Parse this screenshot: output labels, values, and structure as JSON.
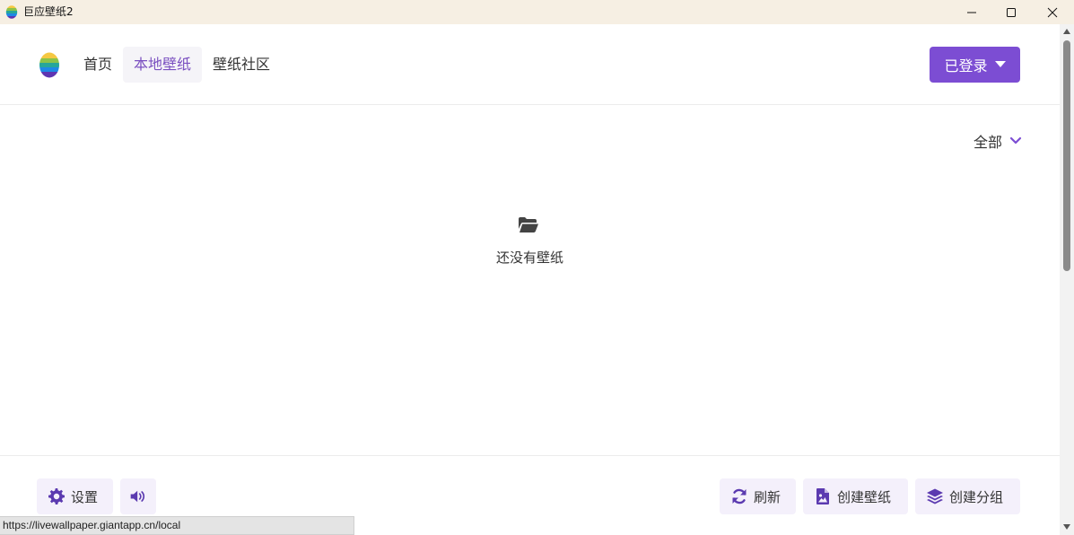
{
  "window": {
    "title": "巨应壁纸2",
    "controls": [
      "minimize",
      "maximize",
      "close"
    ]
  },
  "header": {
    "nav": [
      {
        "label": "首页",
        "active": false
      },
      {
        "label": "本地壁纸",
        "active": true
      },
      {
        "label": "壁纸社区",
        "active": false
      }
    ],
    "login_label": "已登录"
  },
  "filter": {
    "selected": "全部"
  },
  "empty_state": {
    "icon": "folder-open-icon",
    "message": "还没有壁纸"
  },
  "footer": {
    "settings_label": "设置",
    "refresh_label": "刷新",
    "create_wallpaper_label": "创建壁纸",
    "create_group_label": "创建分组"
  },
  "status_url": "https://livewallpaper.giantapp.cn/local",
  "colors": {
    "accent": "#7c4dd3",
    "titlebar": "#f6efe3",
    "button_bg": "#f4f0fb"
  }
}
